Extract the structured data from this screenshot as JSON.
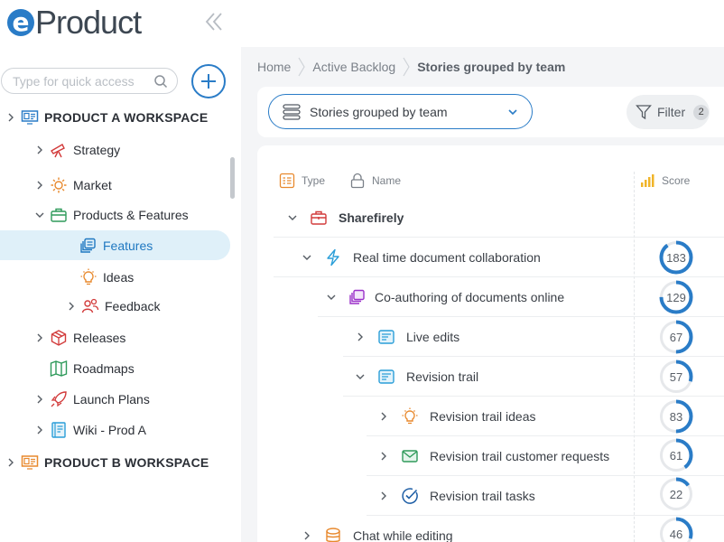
{
  "app": {
    "logo_e": "e",
    "logo_word": "Product"
  },
  "search": {
    "placeholder": "Type for quick access"
  },
  "tree": [
    {
      "label": "PRODUCT A WORKSPACE",
      "icon": "workspace-monitor-icon"
    },
    {
      "label": "Strategy",
      "icon": "telescope-icon"
    },
    {
      "label": "Market",
      "icon": "sun-icon"
    },
    {
      "label": "Products & Features",
      "icon": "briefcase-icon"
    },
    {
      "label": "Features",
      "icon": "layers-icon"
    },
    {
      "label": "Ideas",
      "icon": "lightbulb-icon"
    },
    {
      "label": "Feedback",
      "icon": "people-icon"
    },
    {
      "label": "Releases",
      "icon": "package-icon"
    },
    {
      "label": "Roadmaps",
      "icon": "map-icon"
    },
    {
      "label": "Launch Plans",
      "icon": "rocket-icon"
    },
    {
      "label": "Wiki - Prod A",
      "icon": "book-icon"
    },
    {
      "label": "PRODUCT B WORKSPACE",
      "icon": "workspace-monitor-icon"
    }
  ],
  "breadcrumb": [
    "Home",
    "Active Backlog",
    "Stories grouped by team"
  ],
  "view_select": {
    "value": "Stories grouped by team"
  },
  "filter": {
    "label": "Filter",
    "count": "2"
  },
  "columns": {
    "type": "Type",
    "name": "Name",
    "score": "Score"
  },
  "rows": [
    {
      "label": "Sharefirely",
      "icon": "briefcase-icon"
    },
    {
      "label": "Real time document collaboration",
      "icon": "lightning-icon",
      "score": 183,
      "fill": 0.9
    },
    {
      "label": "Co-authoring of documents online",
      "icon": "layers-icon",
      "score": 129,
      "fill": 0.75
    },
    {
      "label": "Live edits",
      "icon": "story-icon",
      "score": 67,
      "fill": 0.5
    },
    {
      "label": "Revision trail",
      "icon": "story-icon",
      "score": 57,
      "fill": 0.3
    },
    {
      "label": "Revision trail ideas",
      "icon": "lightbulb-icon",
      "score": 83,
      "fill": 0.5
    },
    {
      "label": "Revision trail customer requests",
      "icon": "envelope-icon",
      "score": 61,
      "fill": 0.4
    },
    {
      "label": "Revision trail tasks",
      "icon": "check-circle-icon",
      "score": 22,
      "fill": 0.15
    },
    {
      "label": "Chat while editing",
      "icon": "stack-icon",
      "score": 46,
      "fill": 0.3
    }
  ],
  "colors": {
    "accent": "#2a7cc7",
    "score_ring": "#2a7cc7",
    "score_track": "#e6e8eb"
  }
}
